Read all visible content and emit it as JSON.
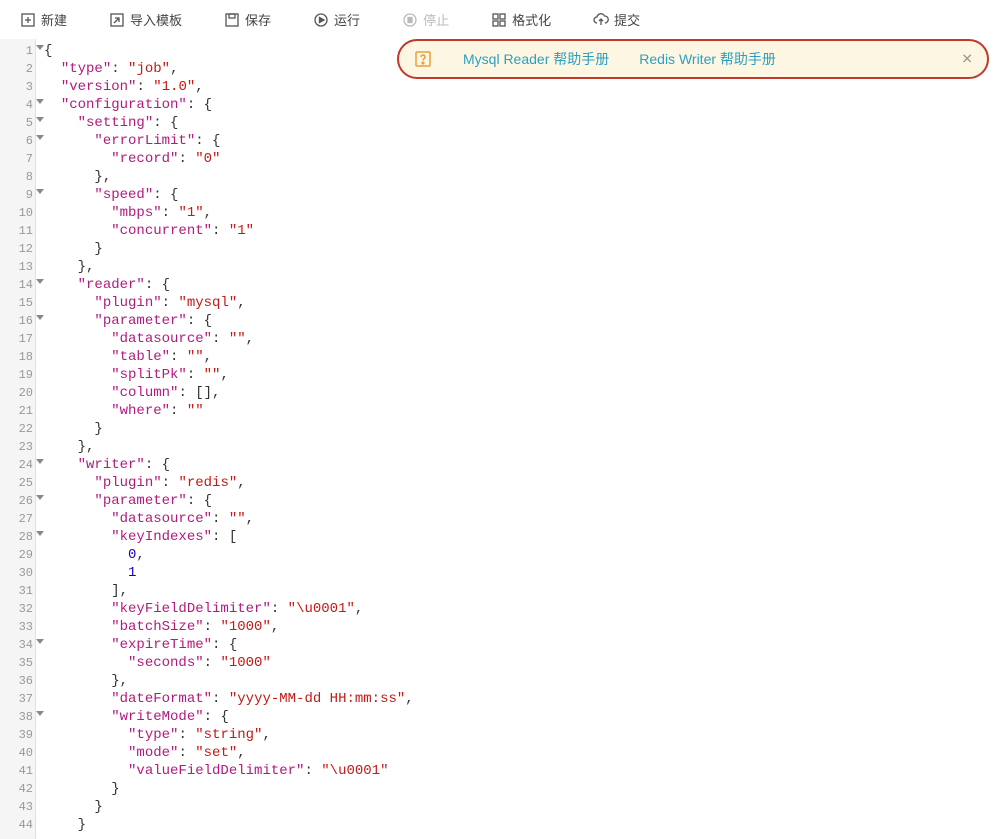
{
  "toolbar": {
    "new": "新建",
    "import": "导入模板",
    "save": "保存",
    "run": "运行",
    "stop": "停止",
    "format": "格式化",
    "submit": "提交"
  },
  "banner": {
    "link1": "Mysql Reader 帮助手册",
    "link2": "Redis Writer 帮助手册"
  },
  "gutter": {
    "lines": 44,
    "fold_lines": [
      1,
      4,
      5,
      6,
      9,
      14,
      16,
      24,
      26,
      28,
      34,
      38
    ]
  },
  "code": [
    {
      "indent": 0,
      "tokens": [
        {
          "t": "p",
          "v": "{"
        }
      ]
    },
    {
      "indent": 1,
      "tokens": [
        {
          "t": "k",
          "v": "\"type\""
        },
        {
          "t": "p",
          "v": ": "
        },
        {
          "t": "s",
          "v": "\"job\""
        },
        {
          "t": "p",
          "v": ","
        }
      ]
    },
    {
      "indent": 1,
      "tokens": [
        {
          "t": "k",
          "v": "\"version\""
        },
        {
          "t": "p",
          "v": ": "
        },
        {
          "t": "s",
          "v": "\"1.0\""
        },
        {
          "t": "p",
          "v": ","
        }
      ]
    },
    {
      "indent": 1,
      "tokens": [
        {
          "t": "k",
          "v": "\"configuration\""
        },
        {
          "t": "p",
          "v": ": {"
        }
      ]
    },
    {
      "indent": 2,
      "tokens": [
        {
          "t": "k",
          "v": "\"setting\""
        },
        {
          "t": "p",
          "v": ": {"
        }
      ]
    },
    {
      "indent": 3,
      "tokens": [
        {
          "t": "k",
          "v": "\"errorLimit\""
        },
        {
          "t": "p",
          "v": ": {"
        }
      ]
    },
    {
      "indent": 4,
      "tokens": [
        {
          "t": "k",
          "v": "\"record\""
        },
        {
          "t": "p",
          "v": ": "
        },
        {
          "t": "s",
          "v": "\"0\""
        }
      ]
    },
    {
      "indent": 3,
      "tokens": [
        {
          "t": "p",
          "v": "},"
        }
      ]
    },
    {
      "indent": 3,
      "tokens": [
        {
          "t": "k",
          "v": "\"speed\""
        },
        {
          "t": "p",
          "v": ": {"
        }
      ]
    },
    {
      "indent": 4,
      "tokens": [
        {
          "t": "k",
          "v": "\"mbps\""
        },
        {
          "t": "p",
          "v": ": "
        },
        {
          "t": "s",
          "v": "\"1\""
        },
        {
          "t": "p",
          "v": ","
        }
      ]
    },
    {
      "indent": 4,
      "tokens": [
        {
          "t": "k",
          "v": "\"concurrent\""
        },
        {
          "t": "p",
          "v": ": "
        },
        {
          "t": "s",
          "v": "\"1\""
        }
      ]
    },
    {
      "indent": 3,
      "tokens": [
        {
          "t": "p",
          "v": "}"
        }
      ]
    },
    {
      "indent": 2,
      "tokens": [
        {
          "t": "p",
          "v": "},"
        }
      ]
    },
    {
      "indent": 2,
      "tokens": [
        {
          "t": "k",
          "v": "\"reader\""
        },
        {
          "t": "p",
          "v": ": {"
        }
      ]
    },
    {
      "indent": 3,
      "tokens": [
        {
          "t": "k",
          "v": "\"plugin\""
        },
        {
          "t": "p",
          "v": ": "
        },
        {
          "t": "s",
          "v": "\"mysql\""
        },
        {
          "t": "p",
          "v": ","
        }
      ]
    },
    {
      "indent": 3,
      "tokens": [
        {
          "t": "k",
          "v": "\"parameter\""
        },
        {
          "t": "p",
          "v": ": {"
        }
      ]
    },
    {
      "indent": 4,
      "tokens": [
        {
          "t": "k",
          "v": "\"datasource\""
        },
        {
          "t": "p",
          "v": ": "
        },
        {
          "t": "s",
          "v": "\"\""
        },
        {
          "t": "p",
          "v": ","
        }
      ]
    },
    {
      "indent": 4,
      "tokens": [
        {
          "t": "k",
          "v": "\"table\""
        },
        {
          "t": "p",
          "v": ": "
        },
        {
          "t": "s",
          "v": "\"\""
        },
        {
          "t": "p",
          "v": ","
        }
      ]
    },
    {
      "indent": 4,
      "tokens": [
        {
          "t": "k",
          "v": "\"splitPk\""
        },
        {
          "t": "p",
          "v": ": "
        },
        {
          "t": "s",
          "v": "\"\""
        },
        {
          "t": "p",
          "v": ","
        }
      ]
    },
    {
      "indent": 4,
      "tokens": [
        {
          "t": "k",
          "v": "\"column\""
        },
        {
          "t": "p",
          "v": ": [],"
        }
      ]
    },
    {
      "indent": 4,
      "tokens": [
        {
          "t": "k",
          "v": "\"where\""
        },
        {
          "t": "p",
          "v": ": "
        },
        {
          "t": "s",
          "v": "\"\""
        }
      ]
    },
    {
      "indent": 3,
      "tokens": [
        {
          "t": "p",
          "v": "}"
        }
      ]
    },
    {
      "indent": 2,
      "tokens": [
        {
          "t": "p",
          "v": "},"
        }
      ]
    },
    {
      "indent": 2,
      "tokens": [
        {
          "t": "k",
          "v": "\"writer\""
        },
        {
          "t": "p",
          "v": ": {"
        }
      ]
    },
    {
      "indent": 3,
      "tokens": [
        {
          "t": "k",
          "v": "\"plugin\""
        },
        {
          "t": "p",
          "v": ": "
        },
        {
          "t": "s",
          "v": "\"redis\""
        },
        {
          "t": "p",
          "v": ","
        }
      ]
    },
    {
      "indent": 3,
      "tokens": [
        {
          "t": "k",
          "v": "\"parameter\""
        },
        {
          "t": "p",
          "v": ": {"
        }
      ]
    },
    {
      "indent": 4,
      "tokens": [
        {
          "t": "k",
          "v": "\"datasource\""
        },
        {
          "t": "p",
          "v": ": "
        },
        {
          "t": "s",
          "v": "\"\""
        },
        {
          "t": "p",
          "v": ","
        }
      ]
    },
    {
      "indent": 4,
      "tokens": [
        {
          "t": "k",
          "v": "\"keyIndexes\""
        },
        {
          "t": "p",
          "v": ": ["
        }
      ]
    },
    {
      "indent": 5,
      "tokens": [
        {
          "t": "n",
          "v": "0"
        },
        {
          "t": "p",
          "v": ","
        }
      ]
    },
    {
      "indent": 5,
      "tokens": [
        {
          "t": "n",
          "v": "1"
        }
      ]
    },
    {
      "indent": 4,
      "tokens": [
        {
          "t": "p",
          "v": "],"
        }
      ]
    },
    {
      "indent": 4,
      "tokens": [
        {
          "t": "k",
          "v": "\"keyFieldDelimiter\""
        },
        {
          "t": "p",
          "v": ": "
        },
        {
          "t": "s",
          "v": "\"\\u0001\""
        },
        {
          "t": "p",
          "v": ","
        }
      ]
    },
    {
      "indent": 4,
      "tokens": [
        {
          "t": "k",
          "v": "\"batchSize\""
        },
        {
          "t": "p",
          "v": ": "
        },
        {
          "t": "s",
          "v": "\"1000\""
        },
        {
          "t": "p",
          "v": ","
        }
      ]
    },
    {
      "indent": 4,
      "tokens": [
        {
          "t": "k",
          "v": "\"expireTime\""
        },
        {
          "t": "p",
          "v": ": {"
        }
      ]
    },
    {
      "indent": 5,
      "tokens": [
        {
          "t": "k",
          "v": "\"seconds\""
        },
        {
          "t": "p",
          "v": ": "
        },
        {
          "t": "s",
          "v": "\"1000\""
        }
      ]
    },
    {
      "indent": 4,
      "tokens": [
        {
          "t": "p",
          "v": "},"
        }
      ]
    },
    {
      "indent": 4,
      "tokens": [
        {
          "t": "k",
          "v": "\"dateFormat\""
        },
        {
          "t": "p",
          "v": ": "
        },
        {
          "t": "s",
          "v": "\"yyyy-MM-dd HH:mm:ss\""
        },
        {
          "t": "p",
          "v": ","
        }
      ]
    },
    {
      "indent": 4,
      "tokens": [
        {
          "t": "k",
          "v": "\"writeMode\""
        },
        {
          "t": "p",
          "v": ": {"
        }
      ]
    },
    {
      "indent": 5,
      "tokens": [
        {
          "t": "k",
          "v": "\"type\""
        },
        {
          "t": "p",
          "v": ": "
        },
        {
          "t": "s",
          "v": "\"string\""
        },
        {
          "t": "p",
          "v": ","
        }
      ]
    },
    {
      "indent": 5,
      "tokens": [
        {
          "t": "k",
          "v": "\"mode\""
        },
        {
          "t": "p",
          "v": ": "
        },
        {
          "t": "s",
          "v": "\"set\""
        },
        {
          "t": "p",
          "v": ","
        }
      ]
    },
    {
      "indent": 5,
      "tokens": [
        {
          "t": "k",
          "v": "\"valueFieldDelimiter\""
        },
        {
          "t": "p",
          "v": ": "
        },
        {
          "t": "s",
          "v": "\"\\u0001\""
        }
      ]
    },
    {
      "indent": 4,
      "tokens": [
        {
          "t": "p",
          "v": "}"
        }
      ]
    },
    {
      "indent": 3,
      "tokens": [
        {
          "t": "p",
          "v": "}"
        }
      ]
    },
    {
      "indent": 2,
      "tokens": [
        {
          "t": "p",
          "v": "}"
        }
      ]
    }
  ]
}
